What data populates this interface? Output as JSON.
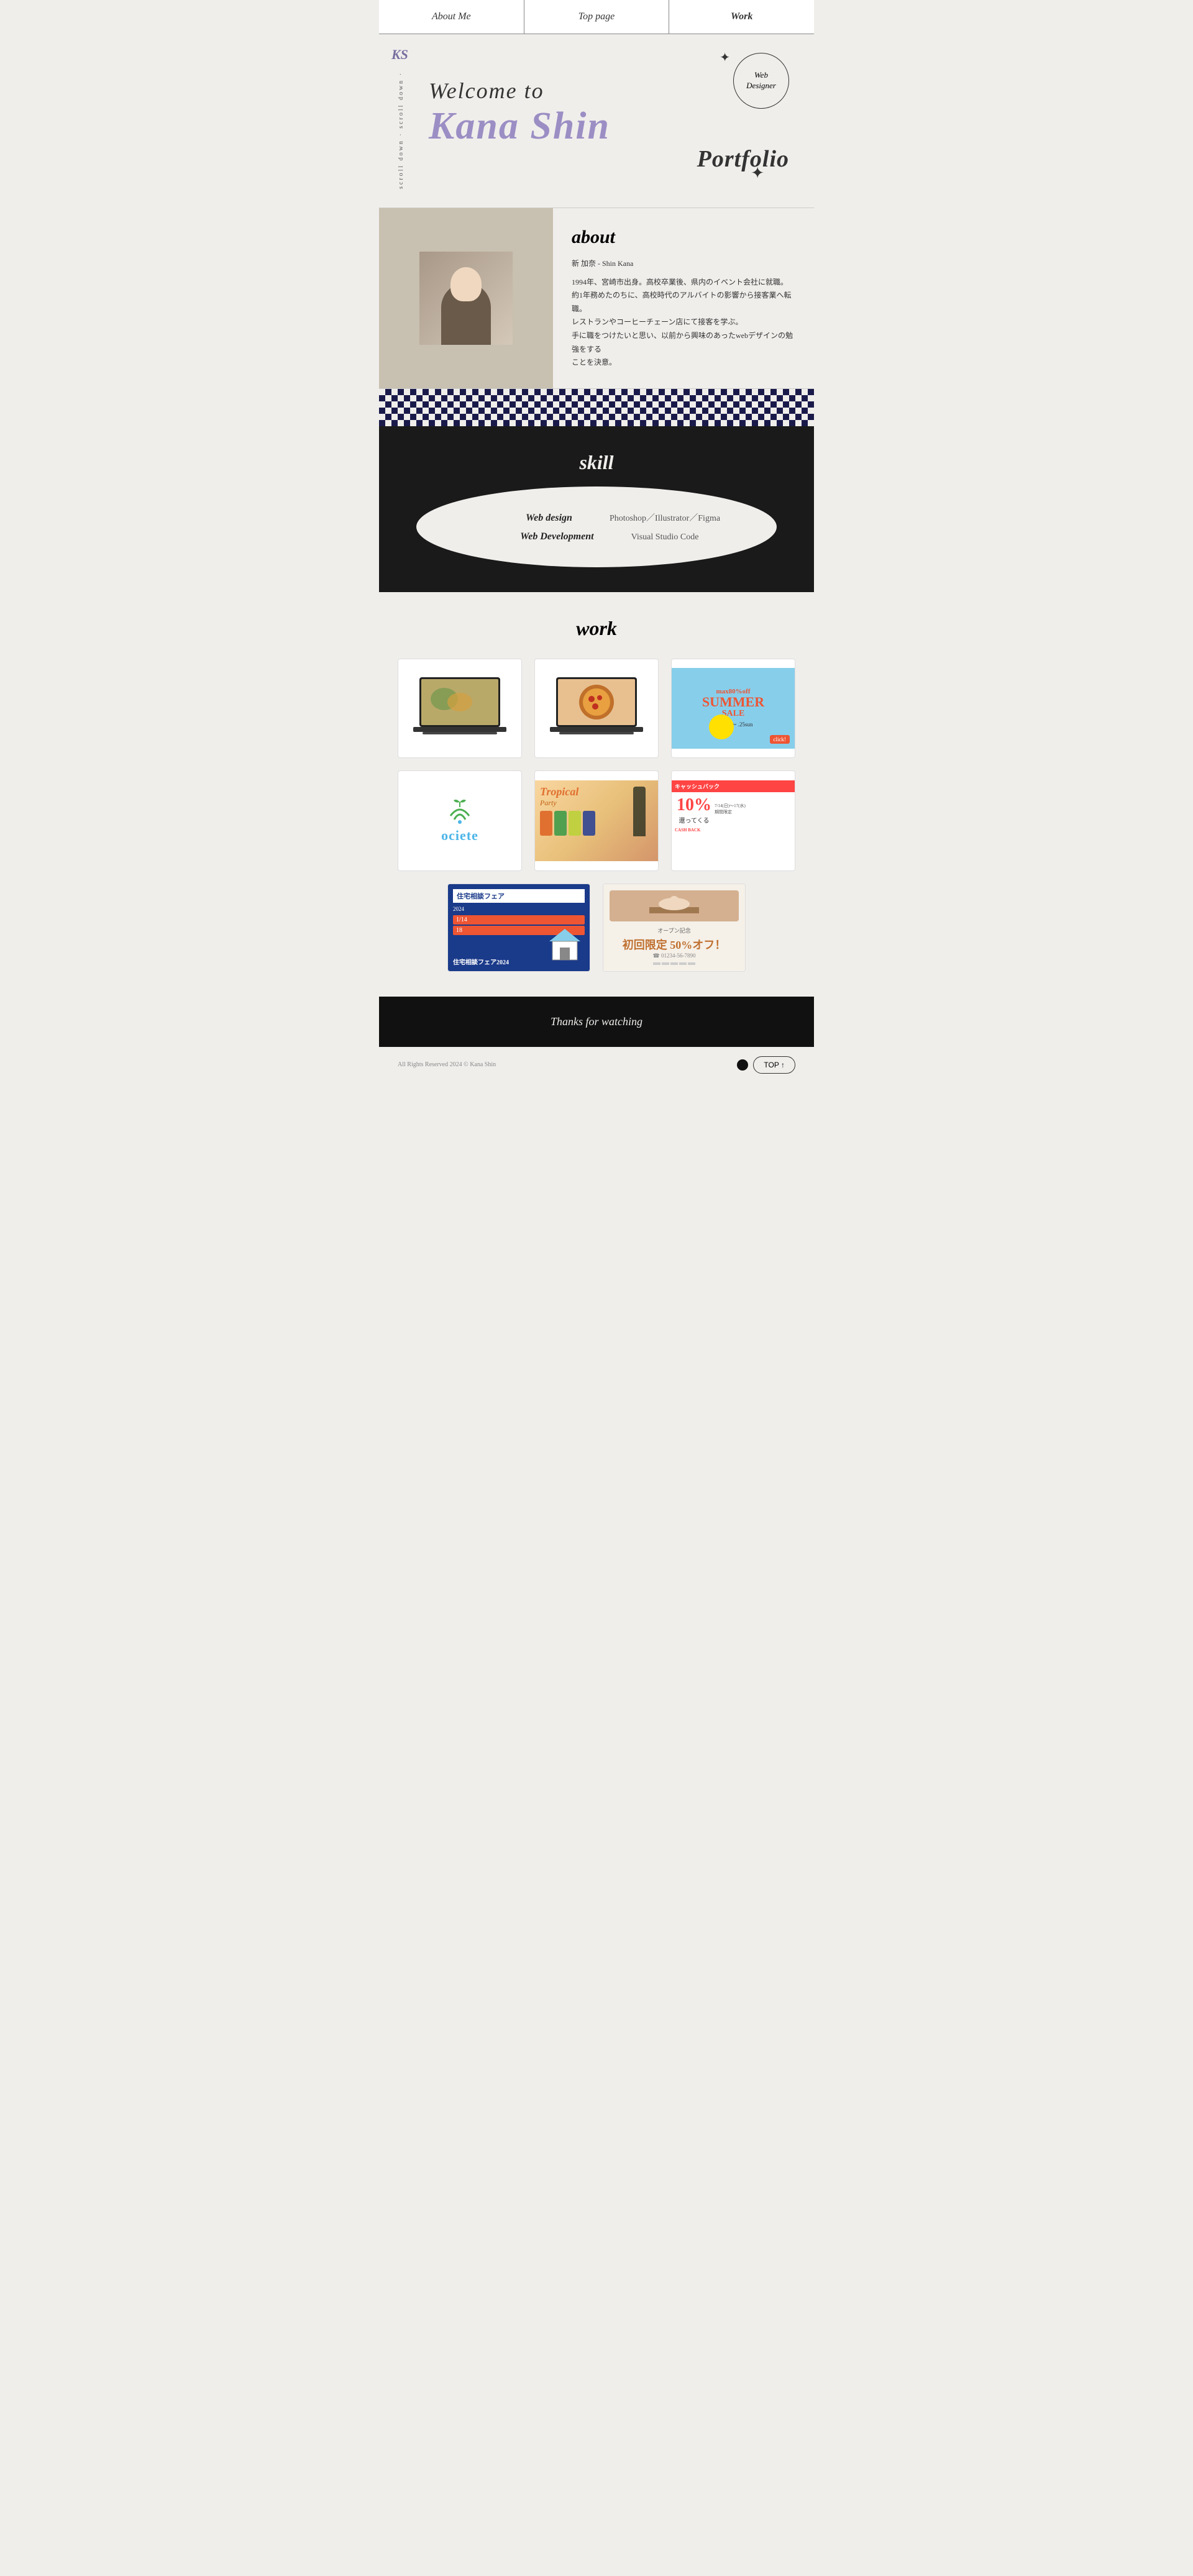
{
  "nav": {
    "items": [
      {
        "label": "About Me",
        "href": "#about",
        "active": false
      },
      {
        "label": "Top page",
        "href": "#top",
        "active": false
      },
      {
        "label": "Work",
        "href": "#work",
        "active": true
      }
    ]
  },
  "hero": {
    "logo": "KS",
    "welcome_line": "Welcome  to",
    "name": "Kana Shin",
    "portfolio": "Portfolio",
    "badge_line1": "Web",
    "badge_line2": "Designer",
    "scroll_text": "scroll down · scroll down ·",
    "stars": "✦",
    "star2": "✦"
  },
  "about": {
    "heading": "about",
    "name_ja": "新 加奈 - Shin Kana",
    "bio": "1994年、宮崎市出身。高校卒業後、県内のイベント会社に就職。\n約1年務めたのちに、高校時代のアルバイトの影響から接客業へ転職。\nレストランやコーヒーチェーン店にて接客を学ぶ。\n手に職をつけたいと思い、以前から興味のあったwebデザインの勉強をすること を決意。"
  },
  "skill": {
    "heading": "skill",
    "rows": [
      {
        "title": "Web design",
        "items": "Photoshop／Illustrator／Figma"
      },
      {
        "title": "Web Development",
        "items": "Visual Studio Code"
      }
    ]
  },
  "work": {
    "heading": "work",
    "items": [
      {
        "type": "laptop1",
        "alt": "Food website laptop mockup"
      },
      {
        "type": "laptop2",
        "alt": "Pizza website laptop mockup"
      },
      {
        "type": "summer_sale",
        "alt": "Summer Sale banner"
      },
      {
        "type": "ociete",
        "alt": "Ociete logo design"
      },
      {
        "type": "tropical",
        "alt": "Tropical menu design"
      },
      {
        "type": "cashback",
        "alt": "Cashback campaign flyer"
      },
      {
        "type": "house",
        "alt": "Housing consultation fair flyer"
      },
      {
        "type": "salon",
        "alt": "Salon opening discount flyer"
      }
    ]
  },
  "footer": {
    "thanks": "Thanks for watching",
    "copyright": "All Rights Reserved 2024 © Kana Shin",
    "top_button": "TOP ↑"
  }
}
